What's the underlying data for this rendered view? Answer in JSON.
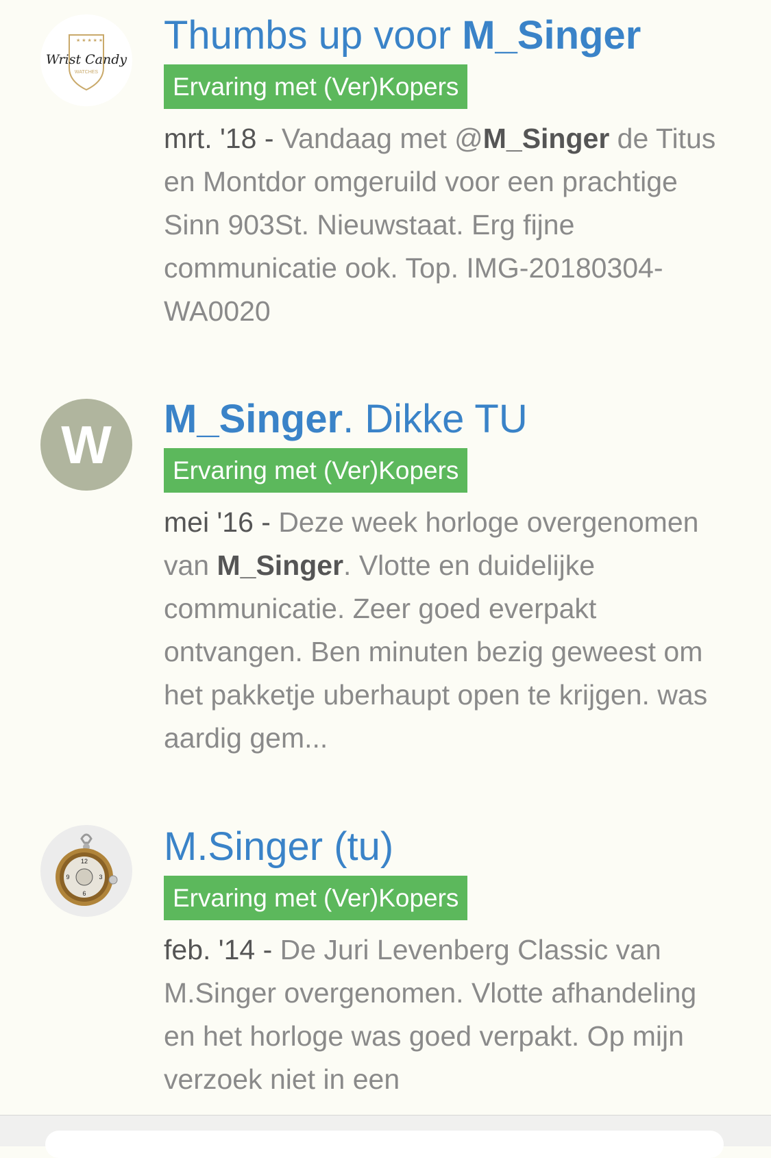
{
  "results": [
    {
      "avatar_icon": "wrist-candy-logo",
      "avatar_text": "Wrist Candy",
      "avatar_subtext": "WATCHES",
      "title_pre": "Thumbs up voor ",
      "title_bold": "M_Singer",
      "title_post": "",
      "tag": "Ervaring met (Ver)Kopers",
      "date": "mrt. '18",
      "sep": " - ",
      "excerpt_pre": "Vandaag met @",
      "excerpt_bold": "M_Singer",
      "excerpt_post": " de Titus en Montdor omgeruild voor een prachtige Sinn 903St. Nieuwstaat. Erg fijne communicatie ook. Top. IMG-20180304-WA0020"
    },
    {
      "avatar_icon": "letter-avatar",
      "avatar_text": "W",
      "title_pre": "",
      "title_bold": "M_Singer",
      "title_post": ". Dikke TU",
      "tag": "Ervaring met (Ver)Kopers",
      "date": "mei '16",
      "sep": " - ",
      "excerpt_pre": "Deze week horloge overgenomen van ",
      "excerpt_bold": "M_Singer",
      "excerpt_post": ". Vlotte en duidelijke communicatie. Zeer goed everpakt ontvangen. Ben minuten bezig geweest om het pakketje uberhaupt open te krijgen. was aardig gem..."
    },
    {
      "avatar_icon": "pocket-watch-photo",
      "title_pre": "M.Singer (tu)",
      "title_bold": "",
      "title_post": "",
      "tag": "Ervaring met (Ver)Kopers",
      "date": "feb. '14",
      "sep": " - ",
      "excerpt_pre": "De Juri Levenberg Classic van M.Singer overgenomen. Vlotte afhandeling en het horloge was goed verpakt. Op mijn verzoek niet in een",
      "excerpt_bold": "",
      "excerpt_post": ""
    }
  ]
}
